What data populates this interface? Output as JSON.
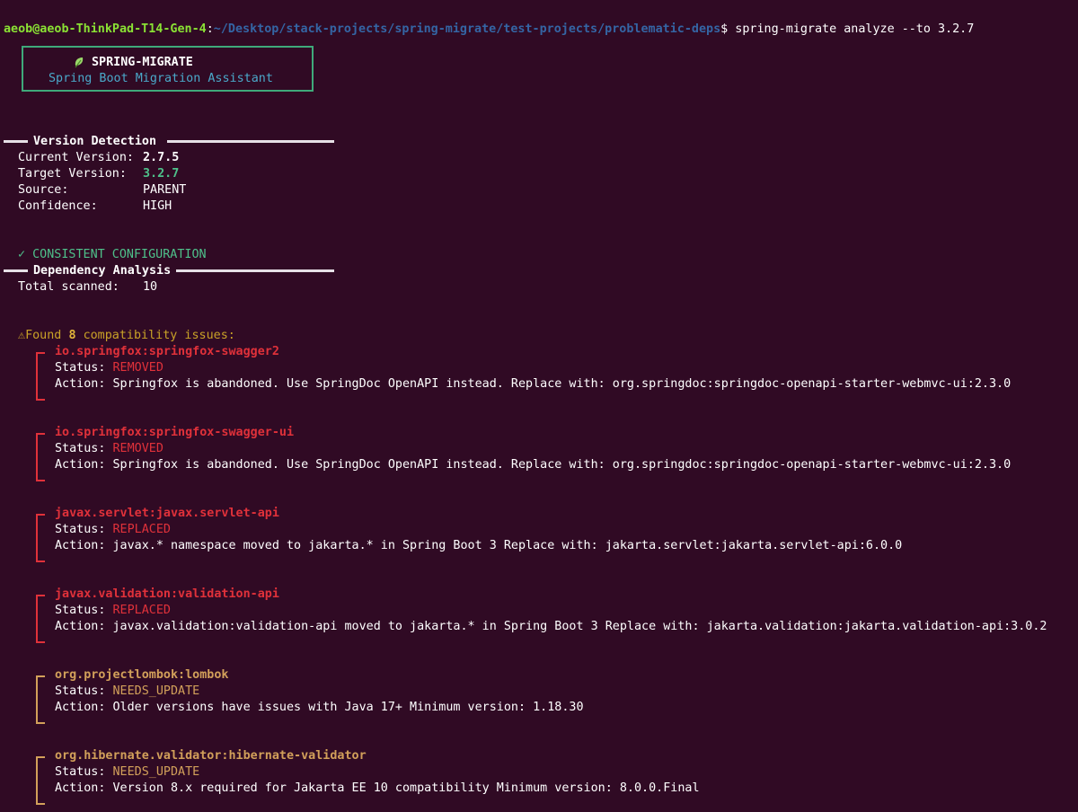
{
  "prompt": {
    "user_host": "aeob@aeob-ThinkPad-T14-Gen-4",
    "separator": ":",
    "path": "~/Desktop/stack-projects/spring-migrate/test-projects/problematic-deps",
    "symbol": "$",
    "command": "spring-migrate analyze --to 3.2.7"
  },
  "banner": {
    "icon": "leaf-icon",
    "title": "SPRING-MIGRATE",
    "subtitle": "Spring Boot Migration Assistant"
  },
  "version_detection": {
    "heading": "Version Detection",
    "rows": [
      {
        "label": "Current Version:",
        "value": "2.7.5"
      },
      {
        "label": "Target Version:",
        "value": "3.2.7"
      },
      {
        "label": "Source:",
        "value": "PARENT"
      },
      {
        "label": "Confidence:",
        "value": "HIGH"
      }
    ],
    "status_icon": "✓",
    "status": "CONSISTENT CONFIGURATION"
  },
  "dependency_analysis": {
    "heading": "Dependency Analysis",
    "total_label": "Total scanned:",
    "total_value": "10",
    "found_icon": "⚠",
    "found_prefix": "Found",
    "found_count": "8",
    "found_suffix": "compatibility issues:"
  },
  "issues": [
    {
      "name": "io.springfox:springfox-swagger2",
      "status_label": "Status:",
      "status": "REMOVED",
      "action_label": "Action:",
      "action": "Springfox is abandoned. Use SpringDoc OpenAPI instead. Replace with: org.springdoc:springdoc-openapi-starter-webmvc-ui:2.3.0",
      "severity_color": "#e0313a"
    },
    {
      "name": "io.springfox:springfox-swagger-ui",
      "status_label": "Status:",
      "status": "REMOVED",
      "action_label": "Action:",
      "action": "Springfox is abandoned. Use SpringDoc OpenAPI instead. Replace with: org.springdoc:springdoc-openapi-starter-webmvc-ui:2.3.0",
      "severity_color": "#e0313a"
    },
    {
      "name": "javax.servlet:javax.servlet-api",
      "status_label": "Status:",
      "status": "REPLACED",
      "action_label": "Action:",
      "action": "javax.* namespace moved to jakarta.* in Spring Boot 3 Replace with: jakarta.servlet:jakarta.servlet-api:6.0.0",
      "severity_color": "#e0313a"
    },
    {
      "name": "javax.validation:validation-api",
      "status_label": "Status:",
      "status": "REPLACED",
      "action_label": "Action:",
      "action": "javax.validation:validation-api moved to jakarta.* in Spring Boot 3 Replace with: jakarta.validation:jakarta.validation-api:3.0.2",
      "severity_color": "#e0313a"
    },
    {
      "name": "org.projectlombok:lombok",
      "status_label": "Status:",
      "status": "NEEDS_UPDATE",
      "action_label": "Action:",
      "action": "Older versions have issues with Java 17+ Minimum version: 1.18.30",
      "severity_color": "#d2a05a"
    },
    {
      "name": "org.hibernate.validator:hibernate-validator",
      "status_label": "Status:",
      "status": "NEEDS_UPDATE",
      "action_label": "Action:",
      "action": "Version 8.x required for Jakarta EE 10 compatibility Minimum version: 8.0.0.Final",
      "severity_color": "#d2a05a"
    }
  ],
  "colors": {
    "background": "#300a24",
    "prompt_user": "#8ae234",
    "prompt_path": "#3465a4",
    "accent_green": "#4ec08a",
    "error_red": "#e0313a",
    "warn_amber": "#d2a05a",
    "banner_border": "#3fa97a",
    "banner_subtitle": "#4aa8c9"
  }
}
